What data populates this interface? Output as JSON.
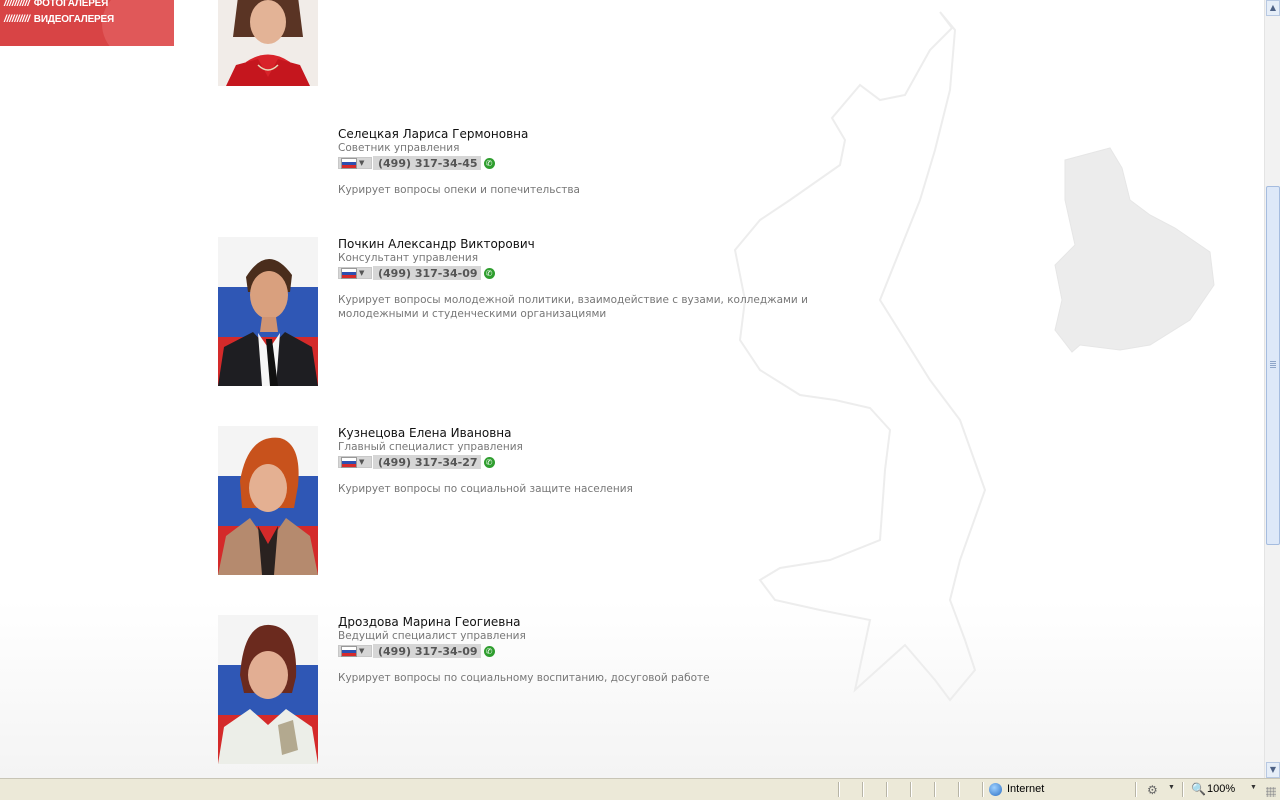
{
  "banner": {
    "items": [
      "ФОТОГАЛЕРЕЯ",
      "ВИДЕОГАЛЕРЕЯ"
    ],
    "prefix": "//////////"
  },
  "staff": [
    {
      "name": "Селецкая Лариса Гермоновна",
      "position": "Советник управления",
      "phone": "(499) 317-34-45",
      "description": "Курирует вопросы опеки и попечительства"
    },
    {
      "name": "Почкин Александр Викторович",
      "position": "Консультант управления",
      "phone": "(499) 317-34-09",
      "description": "Курирует вопросы молодежной политики, взаимодействие с вузами, колледжами и молодежными и студенческими организациями"
    },
    {
      "name": "Кузнецова Елена Ивановна",
      "position": "Главный специалист управления",
      "phone": "(499) 317-34-27",
      "description": "Курирует вопросы по социальной защите населения"
    },
    {
      "name": "Дроздова Марина Геогиевна",
      "position": "Ведущий специалист управления",
      "phone": "(499) 317-34-09",
      "description": "Курирует вопросы по социальному воспитанию, досуговой работе"
    }
  ],
  "statusbar": {
    "zone": "Internet",
    "zoom": "100%"
  },
  "colors": {
    "banner_red": "#d84445",
    "text_dark": "#111111",
    "text_gray": "#777777",
    "call_green": "#2f9e2f"
  }
}
